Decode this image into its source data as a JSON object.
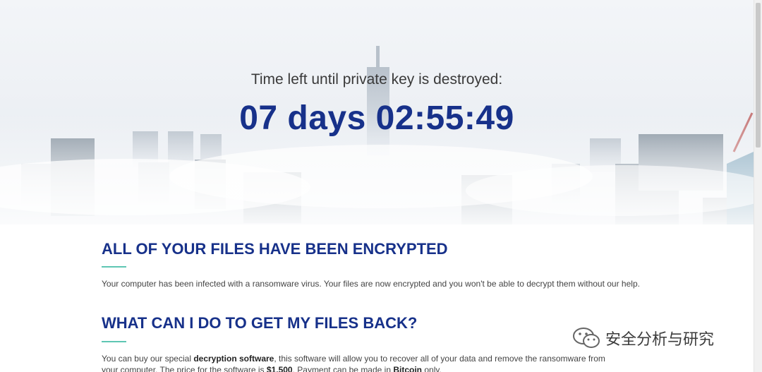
{
  "hero": {
    "countdown_label": "Time left until private key is destroyed:",
    "countdown_value": "07 days 02:55:49"
  },
  "sections": [
    {
      "heading": "ALL OF YOUR FILES HAVE BEEN ENCRYPTED",
      "body": "Your computer has been infected with a ransomware virus. Your files are now encrypted and you won't be able to decrypt them without our help."
    },
    {
      "heading": "WHAT CAN I DO TO GET MY FILES BACK?",
      "body_parts": {
        "p1": "You can buy our special ",
        "b1": "decryption software",
        "p2": ", this software will allow you to recover all of your data and remove the ransomware from your computer. The price for the software is ",
        "b2": "$1,500",
        "p3": ". Payment can be made in ",
        "b3": "Bitcoin",
        "p4": " only."
      }
    }
  ],
  "watermark": {
    "text": "安全分析与研究",
    "icon": "wechat-icon"
  },
  "colors": {
    "heading": "#17318a",
    "accent_underline": "#5ec6b3",
    "body_text": "#444444"
  }
}
